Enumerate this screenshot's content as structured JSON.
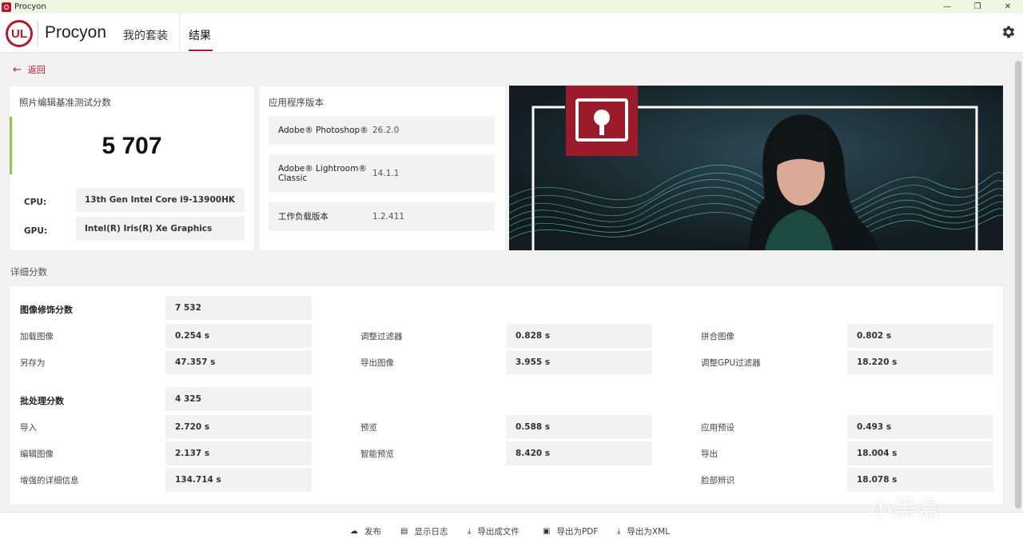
{
  "window": {
    "title": "Procyon",
    "minimize": "—",
    "restore": "❐",
    "close": "✕"
  },
  "header": {
    "logo_text": "UL",
    "app_title": "Procyon",
    "tabs": [
      {
        "label": "我的套装"
      },
      {
        "label": "结果"
      }
    ],
    "active_tab": "结果"
  },
  "back": {
    "label": "返回"
  },
  "score": {
    "label": "照片编辑基准测试分数",
    "value": "5 707",
    "cpu_label": "CPU:",
    "cpu_value": "13th Gen Intel Core i9-13900HK",
    "gpu_label": "GPU:",
    "gpu_value": "Intel(R) Iris(R) Xe Graphics"
  },
  "versions": {
    "label": "应用程序版本",
    "rows": [
      {
        "name": "Adobe® Photoshop®",
        "value": "26.2.0"
      },
      {
        "name": "Adobe® Lightroom® Classic",
        "value": "14.1.1"
      },
      {
        "name": "工作负载版本",
        "value": "1.2.411"
      }
    ]
  },
  "details": {
    "title": "详细分数",
    "retouch": {
      "label": "图像修饰分数",
      "value": "7 532",
      "items": [
        {
          "label": "加载图像",
          "value": "0.254 s"
        },
        {
          "label": "调整过滤器",
          "value": "0.828 s"
        },
        {
          "label": "拼合图像",
          "value": "0.802 s"
        },
        {
          "label": "另存为",
          "value": "47.357 s"
        },
        {
          "label": "导出图像",
          "value": "3.955 s"
        },
        {
          "label": "调整GPU过滤器",
          "value": "18.220 s"
        }
      ]
    },
    "batch": {
      "label": "批处理分数",
      "value": "4 325",
      "items": [
        {
          "label": "导入",
          "value": "2.720 s"
        },
        {
          "label": "预览",
          "value": "0.588 s"
        },
        {
          "label": "应用预设",
          "value": "0.493 s"
        },
        {
          "label": "编辑图像",
          "value": "2.137 s"
        },
        {
          "label": "智能预览",
          "value": "8.420 s"
        },
        {
          "label": "导出",
          "value": "18.004 s"
        },
        {
          "label": "增强的详细信息",
          "value": "134.714 s"
        },
        {
          "label": "脸部辨识",
          "value": "18.078 s"
        }
      ]
    }
  },
  "footer": {
    "buttons": [
      {
        "label": "发布",
        "icon": "cloud-upload-icon",
        "glyph": "☁"
      },
      {
        "label": "显示日志",
        "icon": "document-icon",
        "glyph": "▤"
      },
      {
        "label": "导出成文件",
        "icon": "download-icon",
        "glyph": "⤓"
      },
      {
        "label": "导出为PDF",
        "icon": "save-icon",
        "glyph": "▣"
      },
      {
        "label": "导出为XML",
        "icon": "download-icon",
        "glyph": "⤓"
      }
    ]
  },
  "watermark": "小黑盒",
  "colors": {
    "accent": "#b3192e",
    "score_accent": "#8dc63f",
    "hero_bg": "#16232a",
    "wave": "#5fd6c0"
  }
}
